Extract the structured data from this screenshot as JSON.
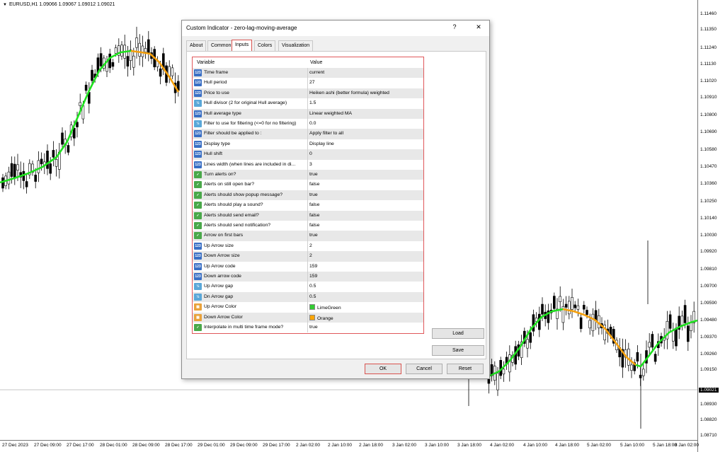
{
  "symbol": "EURUSD,H1  1.09066 1.09067 1.09012 1.09021",
  "y_axis": [
    "1.11460",
    "1.11350",
    "1.11240",
    "1.11130",
    "1.11020",
    "1.10910",
    "1.10800",
    "1.10690",
    "1.10580",
    "1.10470",
    "1.10360",
    "1.10250",
    "1.10140",
    "1.10030",
    "1.09920",
    "1.09810",
    "1.09700",
    "1.09590",
    "1.09480",
    "1.09370",
    "1.09260",
    "1.09150",
    "1.09021",
    "1.08930",
    "1.08820",
    "1.08710"
  ],
  "current_price": "1.09021",
  "x_axis": [
    "27 Dec 2023",
    "27 Dec 09:00",
    "27 Dec 17:00",
    "28 Dec 01:00",
    "28 Dec 09:00",
    "28 Dec 17:00",
    "29 Dec 01:00",
    "29 Dec 09:00",
    "29 Dec 17:00",
    "2 Jan 02:00",
    "2 Jan 10:00",
    "2 Jan 18:00",
    "3 Jan 02:00",
    "3 Jan 10:00",
    "3 Jan 18:00",
    "4 Jan 02:00",
    "4 Jan 10:00",
    "4 Jan 18:00",
    "5 Jan 02:00",
    "5 Jan 10:00",
    "5 Jan 18:00",
    "8 Jan 02:00"
  ],
  "dialog": {
    "title": "Custom Indicator - zero-lag-moving-average",
    "help": "?",
    "close": "✕",
    "tabs": [
      "About",
      "Common",
      "Inputs",
      "Colors",
      "Visualization"
    ],
    "active_tab": "Inputs",
    "col_variable": "Variable",
    "col_value": "Value",
    "rows": [
      {
        "icon": "str",
        "label": "Time frame",
        "value": "current"
      },
      {
        "icon": "num",
        "label": "Hull period",
        "value": "27"
      },
      {
        "icon": "num",
        "label": "Price to use",
        "value": "Heiken ashi (better formula) weighted"
      },
      {
        "icon": "dbl",
        "label": "Hull divisor (2 for original Hull average)",
        "value": "1.5"
      },
      {
        "icon": "num",
        "label": "Hull average type",
        "value": "Linear weighted MA"
      },
      {
        "icon": "dbl",
        "label": "Filter to use for filtering (<=0 for no filtering)",
        "value": "0.0"
      },
      {
        "icon": "num",
        "label": "Filter should be applied to :",
        "value": "Apply filter to all"
      },
      {
        "icon": "num",
        "label": "Display type",
        "value": "Display line"
      },
      {
        "icon": "num",
        "label": "Hull shift",
        "value": "0"
      },
      {
        "icon": "num",
        "label": "Lines width (when lines are included in di...",
        "value": "3"
      },
      {
        "icon": "bool",
        "label": "Turn alerts on?",
        "value": "true"
      },
      {
        "icon": "bool",
        "label": "Alerts on still open bar?",
        "value": "false"
      },
      {
        "icon": "bool",
        "label": "Alerts should show popup message?",
        "value": "true"
      },
      {
        "icon": "bool",
        "label": "Alerts should play a sound?",
        "value": "false"
      },
      {
        "icon": "bool",
        "label": "Alerts should send email?",
        "value": "false"
      },
      {
        "icon": "bool",
        "label": "Alerts should send notification?",
        "value": "false"
      },
      {
        "icon": "bool",
        "label": "Arrow on first bars",
        "value": "true"
      },
      {
        "icon": "num",
        "label": "Up Arrow size",
        "value": "2"
      },
      {
        "icon": "num",
        "label": "Down Arrow size",
        "value": "2"
      },
      {
        "icon": "num",
        "label": "Up Arrow code",
        "value": "159"
      },
      {
        "icon": "num",
        "label": "Down arrow code",
        "value": "159"
      },
      {
        "icon": "dbl",
        "label": "Up Arrow gap",
        "value": "0.5"
      },
      {
        "icon": "dbl",
        "label": "Dn Arrow gap",
        "value": "0.5"
      },
      {
        "icon": "clr",
        "label": "Up Arrow Color",
        "value": "LimeGreen",
        "swatch": "#32cd32"
      },
      {
        "icon": "clr",
        "label": "Down Arrow Color",
        "value": "Orange",
        "swatch": "#ffa500"
      },
      {
        "icon": "bool",
        "label": "Interpolate in multi time frame mode?",
        "value": "true"
      }
    ],
    "load_label": "Load",
    "save_label": "Save",
    "ok_label": "OK",
    "cancel_label": "Cancel",
    "reset_label": "Reset"
  },
  "colors": {
    "up": "#1fe11f",
    "down": "#f5a00c",
    "highlight": "#d9534f"
  }
}
